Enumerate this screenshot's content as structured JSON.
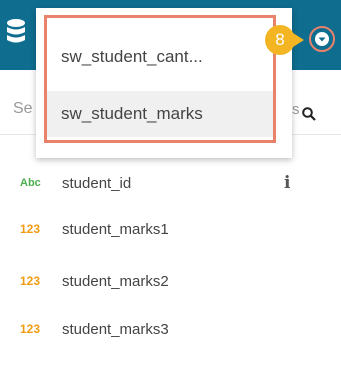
{
  "header": {
    "dropdown_toggle_icon": "chevron-down-circle",
    "db_icon": "database-icon"
  },
  "step_badge": {
    "label": "8",
    "color": "#f3b521"
  },
  "dataset_dropdown": {
    "options": [
      {
        "label": "sw_student_cant..."
      },
      {
        "label": "sw_student_marks"
      }
    ]
  },
  "search": {
    "placeholder": "Se",
    "trailing_visible": "s"
  },
  "columns": [
    {
      "type_label": "Abc",
      "name": "student_id"
    },
    {
      "type_label": "123",
      "name": "student_marks1"
    },
    {
      "type_label": "123",
      "name": "student_marks2"
    },
    {
      "type_label": "123",
      "name": "student_marks3"
    }
  ],
  "colors": {
    "header": "#0f6d8f",
    "highlight": "#e8826a",
    "text_type": "#4caf50",
    "number_type": "#f39c12"
  }
}
